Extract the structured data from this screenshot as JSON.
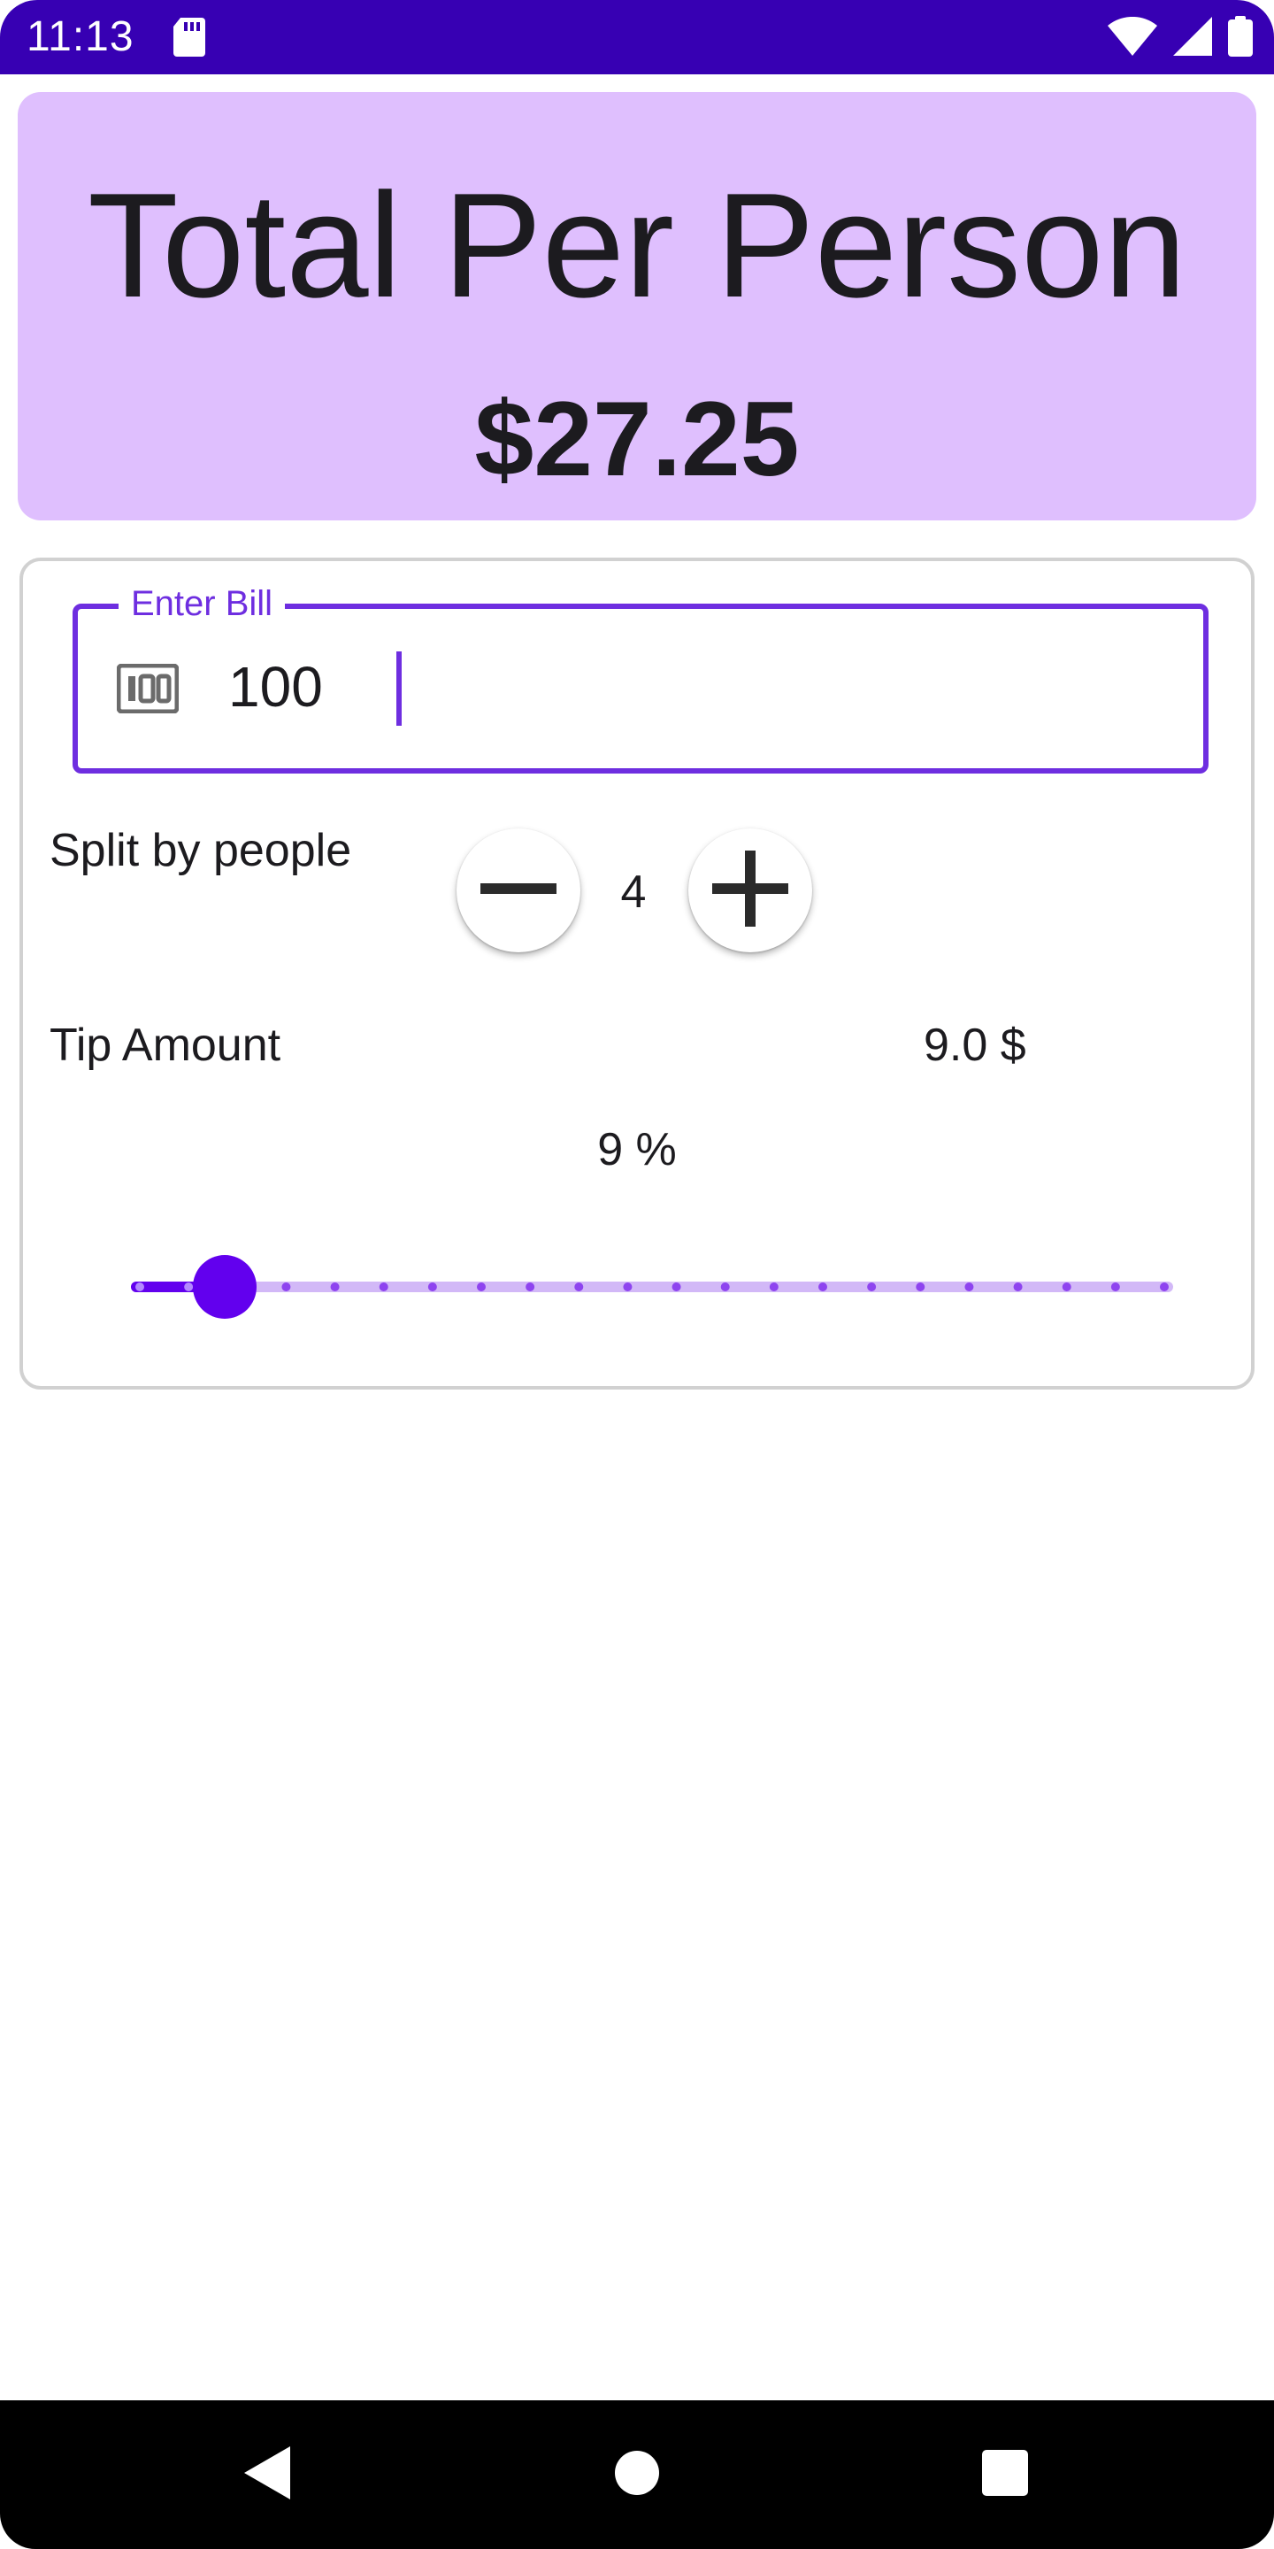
{
  "status_bar": {
    "time": "11:13",
    "icons": [
      "sd-card-icon",
      "wifi-icon",
      "signal-icon",
      "battery-icon"
    ]
  },
  "header": {
    "title": "Total Per Person",
    "amount": "$27.25"
  },
  "bill": {
    "label": "Enter Bill",
    "value": "100",
    "icon": "money-icon"
  },
  "split": {
    "label": "Split by people",
    "count": "4",
    "minus_icon": "minus-icon",
    "plus_icon": "plus-icon"
  },
  "tip": {
    "label": "Tip Amount",
    "amount": "9.0 $",
    "percent": "9 %",
    "slider_value": 9,
    "slider_min": 0,
    "slider_max": 100,
    "slider_steps": 22
  },
  "colors": {
    "status_bar": "#3700b3",
    "header_bg": "#dfbffe",
    "accent": "#6200ee",
    "field_border": "#6e2ee0",
    "track_inactive": "#d2b8f7"
  },
  "nav_bar": {
    "icons": [
      "back-icon",
      "home-icon",
      "recents-icon"
    ]
  }
}
